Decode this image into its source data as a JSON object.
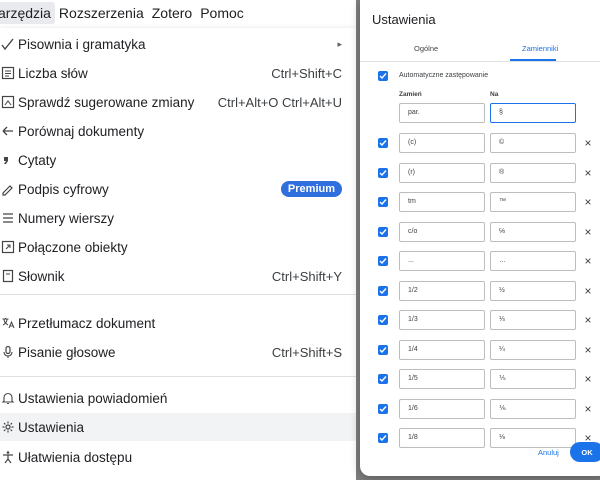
{
  "menubar": {
    "items": [
      "arzędzia",
      "Rozszerzenia",
      "Zotero",
      "Pomoc"
    ]
  },
  "tools_menu": {
    "items": [
      {
        "icon": "spellcheck-icon",
        "label": "Pisownia i gramatyka",
        "submenu": true,
        "arrow": "▸"
      },
      {
        "icon": "word-count-icon",
        "label": "Liczba słów",
        "shortcut": "Ctrl+Shift+C"
      },
      {
        "icon": "review-edits-icon",
        "label": "Sprawdź sugerowane zmiany",
        "shortcut": "Ctrl+Alt+O Ctrl+Alt+U"
      },
      {
        "icon": "compare-icon",
        "label": "Porównaj dokumenty"
      },
      {
        "icon": "quote-icon",
        "label": "Cytaty"
      },
      {
        "icon": "signature-icon",
        "label": "Podpis cyfrowy",
        "badge": "Premium"
      },
      {
        "icon": "line-numbers-icon",
        "label": "Numery wierszy"
      },
      {
        "icon": "linked-objects-icon",
        "label": "Połączone obiekty"
      },
      {
        "icon": "dictionary-icon",
        "label": "Słownik",
        "shortcut": "Ctrl+Shift+Y"
      },
      {
        "icon": "translate-icon",
        "label": "Przetłumacz dokument"
      },
      {
        "icon": "microphone-icon",
        "label": "Pisanie głosowe",
        "shortcut": "Ctrl+Shift+S"
      },
      {
        "icon": "bell-icon",
        "label": "Ustawienia powiadomień"
      },
      {
        "icon": "gear-icon",
        "label": "Ustawienia",
        "highlighted": true
      },
      {
        "icon": "accessibility-icon",
        "label": "Ułatwienia dostępu"
      }
    ]
  },
  "dialog": {
    "title": "Ustawienia",
    "tabs": [
      "Ogólne",
      "Zamienniki"
    ],
    "active_tab": "Zamienniki",
    "auto_replace_label": "Automatyczne zastępowanie",
    "auto_replace_checked": true,
    "col_replace": "Zamień",
    "col_with": "Na",
    "new_row": {
      "from": "par.",
      "to": "§"
    },
    "rows": [
      {
        "from": "(c)",
        "to": "©",
        "checked": true
      },
      {
        "from": "(r)",
        "to": "®",
        "checked": true
      },
      {
        "from": "tm",
        "to": "™",
        "checked": true
      },
      {
        "from": "c/o",
        "to": "℅",
        "checked": true
      },
      {
        "from": "...",
        "to": "…",
        "checked": true
      },
      {
        "from": "1/2",
        "to": "½",
        "checked": true
      },
      {
        "from": "1/3",
        "to": "⅓",
        "checked": true
      },
      {
        "from": "1/4",
        "to": "¼",
        "checked": true
      },
      {
        "from": "1/5",
        "to": "⅕",
        "checked": true
      },
      {
        "from": "1/6",
        "to": "⅙",
        "checked": true
      },
      {
        "from": "1/8",
        "to": "⅛",
        "checked": true
      }
    ],
    "remove_glyph": "×",
    "cancel_label": "Anuluj",
    "ok_label": "OK"
  },
  "colors": {
    "accent": "#1a73e8",
    "premium_badge": "#2f6fde",
    "overlay": "#7f7f7f",
    "highlight": "#f1f3f4"
  }
}
